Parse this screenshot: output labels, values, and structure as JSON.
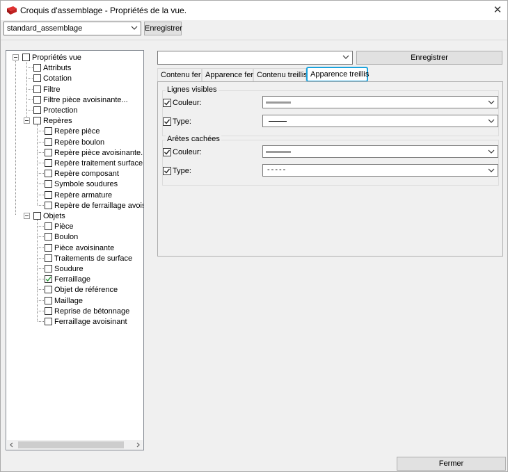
{
  "window": {
    "title": "Croquis d'assemblage - Propriétés de la vue.",
    "close_symbol": "✕",
    "app_icon": "tekla-view-icon",
    "accent_color": "#1aa3dd"
  },
  "preset": {
    "selected": "standard_assemblage",
    "save_label": "Enregistrer"
  },
  "tree": {
    "root": {
      "label": "Propriétés vue",
      "checked": false
    },
    "items": [
      {
        "label": "Attributs",
        "checked": false
      },
      {
        "label": "Cotation",
        "checked": false
      },
      {
        "label": "Filtre",
        "checked": false
      },
      {
        "label": "Filtre pièce avoisinante...",
        "checked": false
      },
      {
        "label": "Protection",
        "checked": false
      },
      {
        "label": "Repères",
        "checked": false
      },
      {
        "label": "Repère pièce",
        "checked": false
      },
      {
        "label": "Repère boulon",
        "checked": false
      },
      {
        "label": "Repère pièce avoisinante...",
        "checked": false
      },
      {
        "label": "Repère traitement surface",
        "checked": false
      },
      {
        "label": "Repère composant",
        "checked": false
      },
      {
        "label": "Symbole soudures",
        "checked": false
      },
      {
        "label": "Repère armature",
        "checked": false
      },
      {
        "label": "Repère de ferraillage avoisinant",
        "checked": false
      },
      {
        "label": "Objets",
        "checked": false
      },
      {
        "label": "Pièce",
        "checked": false
      },
      {
        "label": "Boulon",
        "checked": false
      },
      {
        "label": "Pièce avoisinante",
        "checked": false
      },
      {
        "label": "Traitements de surface",
        "checked": false
      },
      {
        "label": "Soudure",
        "checked": false
      },
      {
        "label": "Ferraillage",
        "checked": true
      },
      {
        "label": "Objet de référence",
        "checked": false
      },
      {
        "label": "Maillage",
        "checked": false
      },
      {
        "label": "Reprise de bétonnage",
        "checked": false
      },
      {
        "label": "Ferraillage avoisinant",
        "checked": false
      }
    ]
  },
  "right": {
    "combo_value": "",
    "save_label": "Enregistrer",
    "tabs": [
      {
        "label": "Contenu fer"
      },
      {
        "label": "Apparence fer"
      },
      {
        "label": "Contenu treillis"
      },
      {
        "label": "Apparence treillis"
      }
    ],
    "visible_lines": {
      "title": "Lignes visibles",
      "color_label": "Couleur:",
      "type_label": "Type:",
      "color_checked": true,
      "type_checked": true
    },
    "hidden_edges": {
      "title": "Arêtes cachées",
      "color_label": "Couleur:",
      "type_label": "Type:",
      "color_checked": true,
      "type_checked": true,
      "type_value": "-----"
    }
  },
  "footer": {
    "close_label": "Fermer"
  }
}
